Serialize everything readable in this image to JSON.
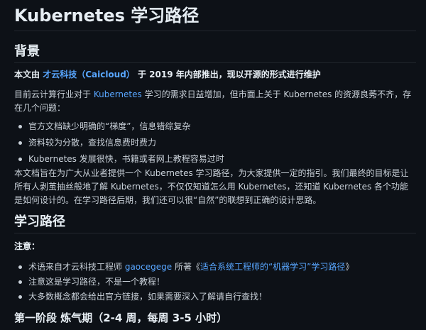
{
  "title": "Kubernetes 学习路径",
  "background": {
    "heading": "背景",
    "intro": {
      "prefix": "本文由 ",
      "org_link": "才云科技（Caicloud）",
      "suffix": " 于 2019 年内部推出，现以开源的形式进行维护"
    },
    "para1": {
      "prefix": "目前云计算行业对于 ",
      "link": "Kubernetes",
      "suffix": " 学习的需求日益增加，但市面上关于 Kubernetes 的资源良莠不齐，存在几个问题："
    },
    "problems": [
      "官方文档缺少明确的“梯度”，信息错综复杂",
      "资料较为分散，查找信息费时费力",
      "Kubernetes 发展很快，书籍或者网上教程容易过时"
    ],
    "para2": "本文档旨在为广大从业者提供一个 Kubernetes 学习路径，为大家提供一定的指引。我们最终的目标是让所有人剥茧抽丝般地了解 Kubernetes，不仅仅知道怎么用 Kubernetes，还知道 Kubernetes 各个功能是如何设计的。在学习路径后期，我们还可以很“自然”的联想到正确的设计思路。"
  },
  "learning_path": {
    "heading": "学习路径",
    "note_label": "注意：",
    "notes": {
      "n1": {
        "prefix": "术语来自才云科技工程师 ",
        "author_link": "gaocegege",
        "middle": " 所著《",
        "article_link": "适合系统工程师的“机器学习”学习路径",
        "suffix": "》"
      },
      "n2": "注意这是学习路径，不是一个教程！",
      "n3": "大多数概念都会给出官方链接，如果需要深入了解请自行查找！"
    }
  },
  "stage1": {
    "heading": "第一阶段 炼气期（2-4 周，每周 3-5 小时）"
  }
}
